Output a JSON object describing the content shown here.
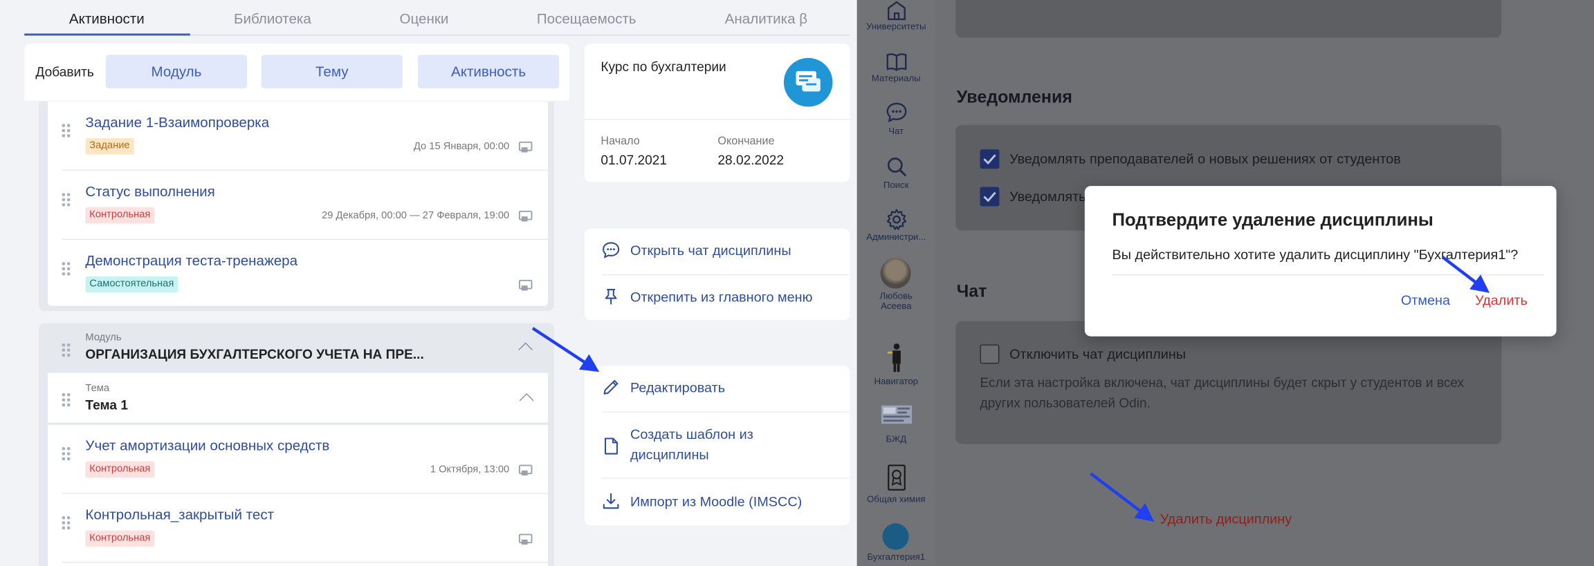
{
  "tabs": [
    {
      "label": "Активности"
    },
    {
      "label": "Библиотека"
    },
    {
      "label": "Оценки"
    },
    {
      "label": "Посещаемость"
    },
    {
      "label": "Аналитика β"
    }
  ],
  "add_bar": {
    "label": "Добавить",
    "buttons": [
      "Модуль",
      "Тему",
      "Активность"
    ]
  },
  "items_top": [
    {
      "title": "Задание 1-Взаимопроверка",
      "badge": "Задание",
      "date": "До 15 Января, 00:00"
    },
    {
      "title": "Статус выполнения",
      "badge": "Контрольная",
      "date": "29 Декабря, 00:00 — 27 Февраля, 19:00"
    },
    {
      "title": "Демонстрация теста-тренажера",
      "badge": "Самостоятельная",
      "date": ""
    }
  ],
  "module": {
    "label": "Модуль",
    "title": "ОРГАНИЗАЦИЯ БУХГАЛТЕРСКОГО УЧЕТА НА ПРЕ..."
  },
  "theme": {
    "label": "Тема",
    "title": "Тема 1"
  },
  "items_bottom": [
    {
      "title": "Учет амортизации основных средств",
      "badge": "Контрольная",
      "date": "1 Октября, 13:00"
    },
    {
      "title": "Контрольная_закрытый тест",
      "badge": "Контрольная",
      "date": ""
    }
  ],
  "course": {
    "title": "Курс по бухгалтерии",
    "start_label": "Начало",
    "start_value": "01.07.2021",
    "end_label": "Окончание",
    "end_value": "28.02.2022"
  },
  "actions_1": [
    "Открыть чат дисциплины",
    "Открепить из главного меню"
  ],
  "actions_2": {
    "edit": "Редактировать",
    "template_l1": "Создать шаблон из",
    "template_l2": "дисциплины",
    "import": "Импорт из Moodle (IMSCC)"
  },
  "sidebar": [
    {
      "label": "Университеты"
    },
    {
      "label": "Материалы"
    },
    {
      "label": "Чат"
    },
    {
      "label": "Поиск"
    },
    {
      "label": "Администри..."
    },
    {
      "label_l1": "Любовь",
      "label_l2": "Асеева"
    },
    {
      "label": "Навигатор"
    },
    {
      "label": "БЖД"
    },
    {
      "label": "Общая химия"
    },
    {
      "label": "Бухгалтерия1"
    }
  ],
  "settings": {
    "notifications_title": "Уведомления",
    "notify_teachers": "Уведомлять преподавателей о новых решениях от студентов",
    "notify_second": "Уведомлять",
    "chat_title": "Чат",
    "disable_chat": "Отключить чат дисциплины",
    "help_text": "Если эта настройка включена, чат дисциплины будет скрыт у студентов и всех других пользователей Odin.",
    "delete_link": "Удалить дисциплину"
  },
  "modal": {
    "title": "Подтвердите удаление дисциплины",
    "text": "Вы действительно хотите удалить дисциплину \"Бухгалтерия1\"?",
    "cancel": "Отмена",
    "confirm": "Удалить"
  },
  "colors": {
    "accent": "#3b5bb4",
    "link": "#2e4d9a",
    "danger": "#e03030",
    "annotation_arrow": "#1f3ff0"
  }
}
